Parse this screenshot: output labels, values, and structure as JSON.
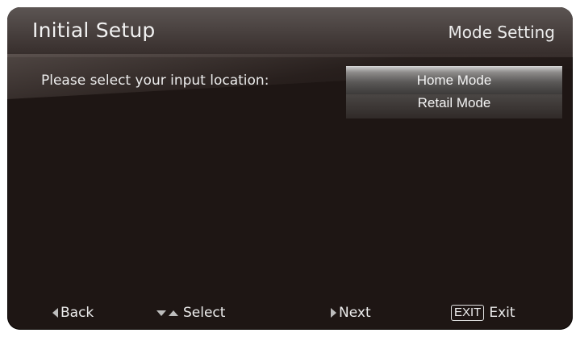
{
  "header": {
    "title": "Initial Setup",
    "section": "Mode Setting"
  },
  "main": {
    "prompt": "Please select your input location:",
    "options": [
      {
        "label": "Home Mode",
        "selected": true
      },
      {
        "label": "Retail Mode",
        "selected": false
      }
    ]
  },
  "footer": {
    "back_label": "Back",
    "select_label": "Select",
    "next_label": "Next",
    "exit_key_label": "EXIT",
    "exit_label": "Exit"
  },
  "colors": {
    "background": "#1e1614",
    "header": "#4a4240",
    "selected_option": "#8d8b8a",
    "text": "#ececec"
  }
}
